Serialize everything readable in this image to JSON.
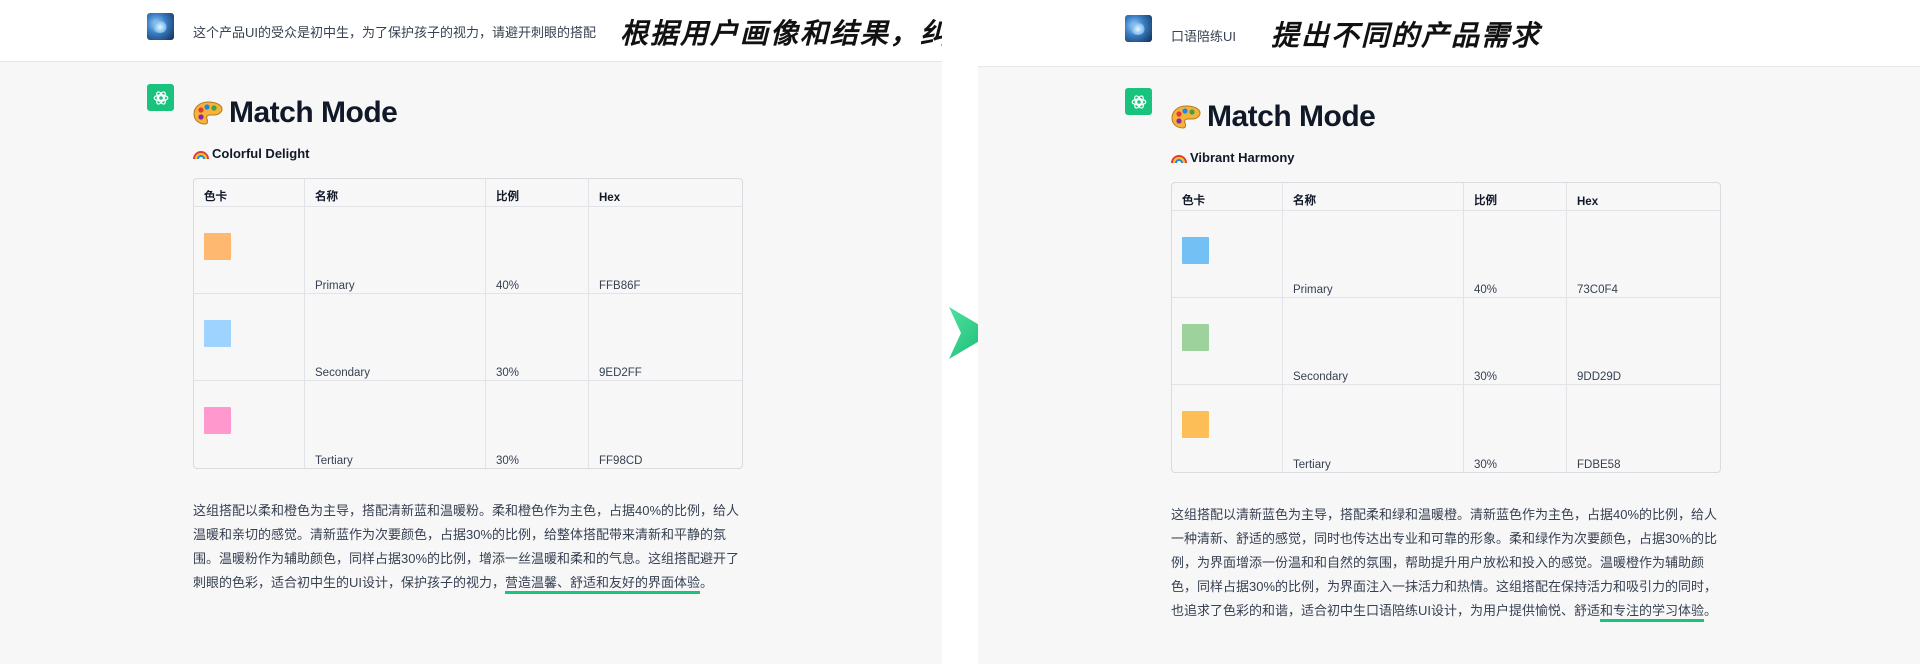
{
  "left": {
    "user_prompt": "这个产品UI的受众是初中生，为了保护孩子的视力，请避开刺眼的搭配",
    "annotation": "根据用户画像和结果，纠偏",
    "mode_title": "Match Mode",
    "scheme_name": "Colorful Delight",
    "table": {
      "headers": [
        "色卡",
        "名称",
        "比例",
        "Hex"
      ],
      "rows": [
        {
          "color": "#FFB86F",
          "name": "Primary",
          "ratio": "40%",
          "hex": "FFB86F"
        },
        {
          "color": "#9ED2FF",
          "name": "Secondary",
          "ratio": "30%",
          "hex": "9ED2FF"
        },
        {
          "color": "#FF98CD",
          "name": "Tertiary",
          "ratio": "30%",
          "hex": "FF98CD"
        }
      ]
    },
    "description_main": "这组搭配以柔和橙色为主导，搭配清新蓝和温暖粉。柔和橙色作为主色，占据40%的比例，给人温暖和亲切的感觉。清新蓝作为次要颜色，占据30%的比例，给整体搭配带来清新和平静的氛围。温暖粉作为辅助颜色，同样占据30%的比例，增添一丝温暖和柔和的气息。这组搭配避开了刺眼的色彩，适合初中生的UI设计，保护孩子的视力，",
    "description_highlight": "营造温馨、舒适和友好的界面体验",
    "description_end": "。"
  },
  "right": {
    "user_prompt": "口语陪练UI",
    "annotation": "提出不同的产品需求",
    "mode_title": "Match Mode",
    "scheme_name": "Vibrant Harmony",
    "table": {
      "headers": [
        "色卡",
        "名称",
        "比例",
        "Hex"
      ],
      "rows": [
        {
          "color": "#73C0F4",
          "name": "Primary",
          "ratio": "40%",
          "hex": "73C0F4"
        },
        {
          "color": "#9DD29D",
          "name": "Secondary",
          "ratio": "30%",
          "hex": "9DD29D"
        },
        {
          "color": "#FDBE58",
          "name": "Tertiary",
          "ratio": "30%",
          "hex": "FDBE58"
        }
      ]
    },
    "description_main": "这组搭配以清新蓝色为主导，搭配柔和绿和温暖橙。清新蓝色作为主色，占据40%的比例，给人一种清新、舒适的感觉，同时也传达出专业和可靠的形象。柔和绿作为次要颜色，占据30%的比例，为界面增添一份温和和自然的氛围，帮助提升用户放松和投入的感觉。温暖橙作为辅助颜色，同样占据30%的比例，为界面注入一抹活力和热情。这组搭配在保持活力和吸引力的同时，也追求了色彩的和谐，适合初中生口语陪练UI设计，为用户提供愉悦、舒适",
    "description_highlight": "和专注的学习体验",
    "description_end": "。"
  },
  "colors": {
    "gpt_green": "#19C37D",
    "arrow_green": "#2FD186",
    "assistant_bg": "#F7F7F8"
  },
  "icons": {
    "user_avatar": "user-avatar-image",
    "assistant": "chatgpt-logo-icon",
    "title_emoji": "artist-palette-icon",
    "scheme_emoji": "rainbow-icon",
    "divider": "arrow-right-icon"
  }
}
